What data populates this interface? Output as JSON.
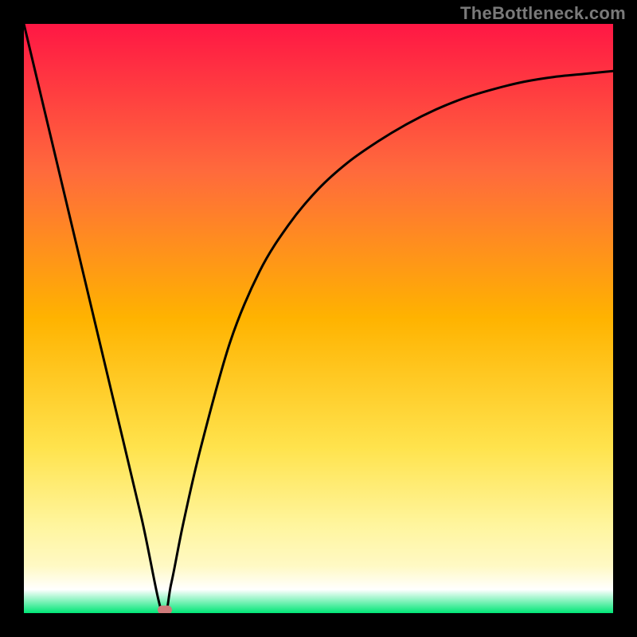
{
  "attribution": "TheBottleneck.com",
  "chart_data": {
    "type": "line",
    "title": "",
    "xlabel": "",
    "ylabel": "",
    "xlim": [
      0,
      100
    ],
    "ylim": [
      0,
      100
    ],
    "grid": false,
    "gradient_stops": [
      {
        "offset": 0,
        "color": "#ff1744"
      },
      {
        "offset": 0.25,
        "color": "#ff6a3c"
      },
      {
        "offset": 0.5,
        "color": "#ffb300"
      },
      {
        "offset": 0.72,
        "color": "#ffe34d"
      },
      {
        "offset": 0.85,
        "color": "#fff59d"
      },
      {
        "offset": 0.92,
        "color": "#fff9c4"
      },
      {
        "offset": 0.96,
        "color": "#ffffff"
      },
      {
        "offset": 1.0,
        "color": "#00e676"
      }
    ],
    "series": [
      {
        "name": "bottleneck-curve",
        "x": [
          0,
          5,
          10,
          15,
          20,
          23.5,
          25,
          27,
          30,
          35,
          40,
          45,
          50,
          55,
          60,
          65,
          70,
          75,
          80,
          85,
          90,
          95,
          100
        ],
        "y": [
          100,
          79,
          58,
          37,
          16,
          0,
          5,
          15,
          28,
          46,
          58,
          66,
          72,
          76.5,
          80,
          83,
          85.5,
          87.5,
          89,
          90.2,
          91,
          91.5,
          92
        ]
      }
    ],
    "marker": {
      "x": 23.9,
      "y": 0.5
    }
  }
}
